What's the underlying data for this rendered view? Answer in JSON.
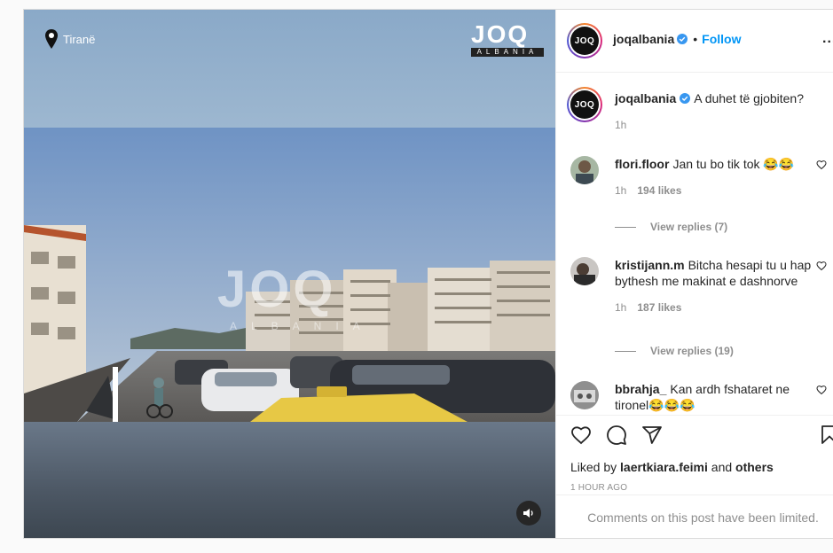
{
  "media": {
    "location": "Tiranë",
    "logo_word": "JOQ",
    "logo_sub": "ALBANIA",
    "watermark_word": "JOQ",
    "watermark_sub": "ALBANIA",
    "sound_icon": "speaker-icon"
  },
  "header": {
    "username": "joqalbania",
    "avatar_text": "JOQ",
    "separator": "•",
    "follow_label": "Follow",
    "more_label": "..."
  },
  "caption": {
    "username": "joqalbania",
    "text": "A duhet të gjobiten?",
    "time": "1h"
  },
  "comments": [
    {
      "username": "flori.floor",
      "text": "Jan tu bo tik tok 😂😂",
      "time": "1h",
      "likes": "194 likes",
      "replies": "View replies (7)"
    },
    {
      "username": "kristijann.m",
      "text": "Bitcha hesapi tu u hap bythesh me makinat e dashnorve",
      "time": "1h",
      "likes": "187 likes",
      "replies": "View replies (19)"
    },
    {
      "username": "bbrahja_",
      "text": "Kan ardh fshataret ne tironel😂😂😂"
    }
  ],
  "actions": {
    "liked_prefix": "Liked by",
    "liked_user": "laertkiara.feimi",
    "liked_and": "and",
    "liked_others": "others",
    "time_ago": "1 HOUR AGO"
  },
  "footer": {
    "limited_text": "Comments on this post have been limited."
  },
  "colors": {
    "accent": "#0095f6",
    "muted": "#8e8e8e",
    "text": "#262626"
  }
}
